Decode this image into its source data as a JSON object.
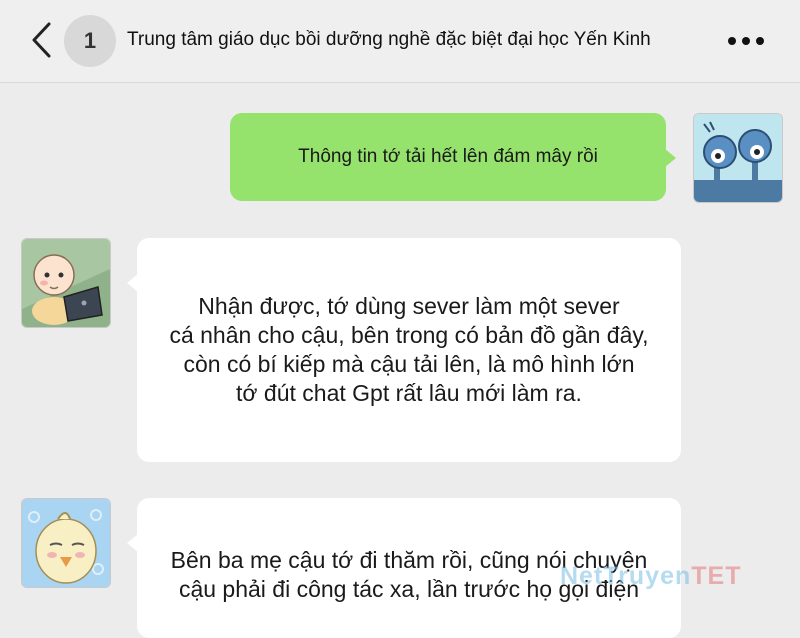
{
  "header": {
    "unread_count": "1",
    "title": "Trung tâm giáo dục bồi dưỡng nghề đặc biệt đại học Yến Kinh"
  },
  "messages": [
    {
      "direction": "sent",
      "avatar": "robot-avatar",
      "text": "Thông tin tớ tải hết lên đám mây rồi"
    },
    {
      "direction": "received",
      "avatar": "baby-laptop-avatar",
      "lines": [
        "Nhận được, tớ dùng sever làm một sever",
        "cá nhân cho cậu, bên trong có bản đồ gần đây,",
        "còn có bí kiếp mà cậu tải lên, là mô hình lớn",
        "tớ đút chat Gpt rất lâu mới làm ra."
      ]
    },
    {
      "direction": "received",
      "avatar": "chick-avatar",
      "lines": [
        "Bên ba mẹ cậu tớ đi thăm rồi, cũng nói chuyện",
        "cậu phải đi công tác xa, lần trước họ gọi điện"
      ]
    }
  ],
  "watermark": {
    "part1": "NetTruyen",
    "part2": "TET"
  },
  "colors": {
    "sent_bubble": "#95e26c",
    "received_bubble": "#ffffff",
    "background": "#ececec"
  }
}
